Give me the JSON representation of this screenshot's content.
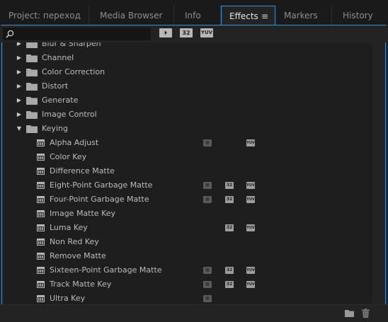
{
  "tabs": [
    {
      "label": "Project: переход",
      "active": false
    },
    {
      "label": "Media Browser",
      "active": false
    },
    {
      "label": "Info",
      "active": false
    },
    {
      "label": "Effects",
      "active": true
    },
    {
      "label": "Markers",
      "active": false
    },
    {
      "label": "History",
      "active": false
    }
  ],
  "panel_menu_icon": "hamburger-icon",
  "search": {
    "value": "",
    "placeholder": ""
  },
  "filter_buttons": [
    {
      "label": "⏵",
      "icon": "accelerated-effects-icon"
    },
    {
      "label": "32",
      "icon": "32-bit-icon"
    },
    {
      "label": "YUV",
      "icon": "yuv-icon"
    }
  ],
  "tree": {
    "partial_top": "Blur & Sharpen",
    "folders": [
      {
        "label": "Channel",
        "expanded": false
      },
      {
        "label": "Color Correction",
        "expanded": false
      },
      {
        "label": "Distort",
        "expanded": false
      },
      {
        "label": "Generate",
        "expanded": false
      },
      {
        "label": "Image Control",
        "expanded": false
      },
      {
        "label": "Keying",
        "expanded": true
      }
    ],
    "effects": [
      {
        "label": "Alpha Adjust",
        "accel": true,
        "b32": false,
        "yuv": true
      },
      {
        "label": "Color Key",
        "accel": false,
        "b32": false,
        "yuv": false
      },
      {
        "label": "Difference Matte",
        "accel": false,
        "b32": false,
        "yuv": false
      },
      {
        "label": "Eight-Point Garbage Matte",
        "accel": true,
        "b32": true,
        "yuv": true
      },
      {
        "label": "Four-Point Garbage Matte",
        "accel": true,
        "b32": true,
        "yuv": true
      },
      {
        "label": "Image Matte Key",
        "accel": false,
        "b32": false,
        "yuv": false
      },
      {
        "label": "Luma Key",
        "accel": false,
        "b32": true,
        "yuv": true
      },
      {
        "label": "Non Red Key",
        "accel": false,
        "b32": false,
        "yuv": false
      },
      {
        "label": "Remove Matte",
        "accel": false,
        "b32": false,
        "yuv": false
      },
      {
        "label": "Sixteen-Point Garbage Matte",
        "accel": true,
        "b32": true,
        "yuv": true
      },
      {
        "label": "Track Matte Key",
        "accel": true,
        "b32": true,
        "yuv": true
      },
      {
        "label": "Ultra Key",
        "accel": true,
        "b32": false,
        "yuv": false
      }
    ]
  },
  "bottom": {
    "new_bin_icon": "new-folder-icon",
    "delete_icon": "trash-icon"
  },
  "colors": {
    "accent": "#3d8fd6",
    "background": "#1e1e1e"
  }
}
